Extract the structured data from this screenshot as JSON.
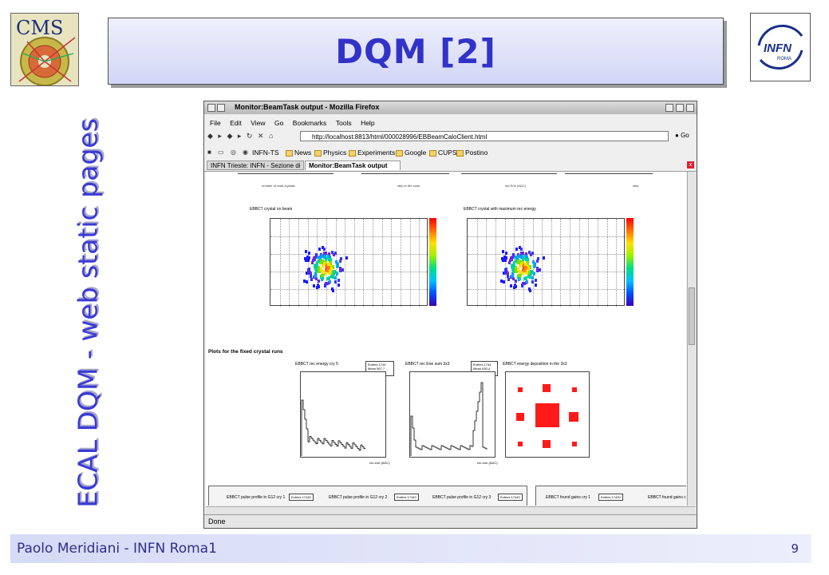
{
  "slide": {
    "title": "DQM [2]",
    "side_title": "ECAL DQM - web static pages",
    "footer_author": "Paolo Meridiani - INFN Roma1",
    "page_number": "9",
    "logo_cms_text": "CMS",
    "logo_infn_text": "INFN",
    "logo_infn_sub": "ROMA"
  },
  "browser": {
    "window_title": "Monitor:BeamTask output - Mozilla Firefox",
    "menu": [
      "File",
      "Edit",
      "View",
      "Go",
      "Bookmarks",
      "Tools",
      "Help"
    ],
    "url": "http://localhost:8813/html/000028996/EBBeamCaloClient.html",
    "go_label": "Go",
    "bookmarks": [
      "INFN-TS",
      "News",
      "Physics",
      "Experiments",
      "Google",
      "CUPS",
      "Postino"
    ],
    "tabs": [
      "INFN Trieste: INFN - Sezione di ...",
      "Monitor:BeamTask output"
    ],
    "status": "Done"
  },
  "page": {
    "top_axis_labels": [
      "number of read crystals",
      "step in the scan",
      "rec Ene (ADC)",
      "step"
    ],
    "heatmap_titles": [
      "EBBCT crystal on beam",
      "EBBCT crystal with maximum rec energy"
    ],
    "section_heading": "Plots for the fixed crystal runs",
    "hist_titles": [
      "EBBCT rec energy cry 5",
      "EBBCT rec Ene sum 3x3",
      "EBBCT energy deposition in the 3x3"
    ],
    "stats": [
      {
        "entries": "Entries  1744",
        "mean": "Mean   567.7",
        "rms": "RMS    284.1"
      },
      {
        "entries": "Entries  1744",
        "mean": "Mean   630.4",
        "rms": "RMS    423.2"
      }
    ],
    "hist_xlabel": "rec ene (ADC)",
    "bottom_panels": [
      {
        "label": "EBBCT pulse profile in G12 cry 1",
        "entries": "Entries  17430"
      },
      {
        "label": "EBBCT pulse profile in G12 cry 2",
        "entries": "Entries  17440"
      },
      {
        "label": "EBBCT pulse profile in G12 cry 3",
        "entries": "Entries  17440"
      },
      {
        "label": "EBBCT found gains cry 1",
        "entries": "Entries  17430"
      },
      {
        "label": "EBBCT found gains c",
        "entries": ""
      }
    ]
  }
}
